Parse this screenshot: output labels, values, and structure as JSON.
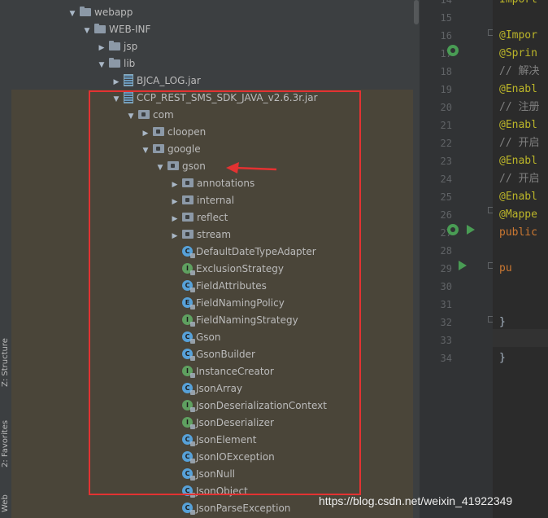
{
  "sidebar_tabs": {
    "structure": "Z: Structure",
    "favorites": "2: Favorites",
    "web": "Web"
  },
  "tree": [
    {
      "label": "webapp",
      "icon": "folder-icon",
      "arrow": "▼"
    },
    {
      "label": "WEB-INF",
      "icon": "folder-icon",
      "arrow": "▼"
    },
    {
      "label": "jsp",
      "icon": "folder-icon",
      "arrow": "▶"
    },
    {
      "label": "lib",
      "icon": "folder-icon",
      "arrow": "▼"
    },
    {
      "label": "BJCA_LOG.jar",
      "icon": "jar-icon",
      "arrow": "▶"
    },
    {
      "label": "CCP_REST_SMS_SDK_JAVA_v2.6.3r.jar",
      "icon": "jar-icon",
      "arrow": "▼"
    },
    {
      "label": "com",
      "icon": "package-icon",
      "arrow": "▼"
    },
    {
      "label": "cloopen",
      "icon": "package-icon",
      "arrow": "▶"
    },
    {
      "label": "google",
      "icon": "package-icon",
      "arrow": "▼"
    },
    {
      "label": "gson",
      "icon": "package-icon",
      "arrow": "▼"
    },
    {
      "label": "annotations",
      "icon": "package-icon",
      "arrow": "▶"
    },
    {
      "label": "internal",
      "icon": "package-icon",
      "arrow": "▶"
    },
    {
      "label": "reflect",
      "icon": "package-icon",
      "arrow": "▶"
    },
    {
      "label": "stream",
      "icon": "package-icon",
      "arrow": "▶"
    },
    {
      "label": "DefaultDateTypeAdapter",
      "icon": "class-icon",
      "kind": "C"
    },
    {
      "label": "ExclusionStrategy",
      "icon": "interface-icon",
      "kind": "I"
    },
    {
      "label": "FieldAttributes",
      "icon": "class-icon",
      "kind": "C"
    },
    {
      "label": "FieldNamingPolicy",
      "icon": "enum-icon",
      "kind": "E"
    },
    {
      "label": "FieldNamingStrategy",
      "icon": "interface-icon",
      "kind": "I"
    },
    {
      "label": "Gson",
      "icon": "class-icon",
      "kind": "C"
    },
    {
      "label": "GsonBuilder",
      "icon": "class-icon",
      "kind": "C"
    },
    {
      "label": "InstanceCreator",
      "icon": "interface-icon",
      "kind": "I"
    },
    {
      "label": "JsonArray",
      "icon": "class-icon",
      "kind": "C"
    },
    {
      "label": "JsonDeserializationContext",
      "icon": "interface-icon",
      "kind": "I"
    },
    {
      "label": "JsonDeserializer",
      "icon": "interface-icon",
      "kind": "I"
    },
    {
      "label": "JsonElement",
      "icon": "abstract-class-icon",
      "kind": "C"
    },
    {
      "label": "JsonIOException",
      "icon": "exception-class-icon",
      "kind": "C"
    },
    {
      "label": "JsonNull",
      "icon": "class-icon",
      "kind": "C"
    },
    {
      "label": "JsonObject",
      "icon": "class-icon",
      "kind": "C"
    },
    {
      "label": "JsonParseException",
      "icon": "exception-class-icon",
      "kind": "C"
    }
  ],
  "gutter": {
    "line_numbers": [
      "14",
      "15",
      "16",
      "17",
      "18",
      "19",
      "20",
      "21",
      "22",
      "23",
      "24",
      "25",
      "26",
      "27",
      "28",
      "29",
      "30",
      "31",
      "32",
      "33",
      "34"
    ]
  },
  "code_lines": [
    {
      "text": "Import",
      "cls": "c-ann"
    },
    {
      "text": "",
      "cls": "c-txt"
    },
    {
      "text": "@Impor",
      "cls": "c-ann"
    },
    {
      "text": "@Sprin",
      "cls": "c-ann"
    },
    {
      "text": "// 解决",
      "cls": "c-cmt"
    },
    {
      "text": "@Enabl",
      "cls": "c-ann"
    },
    {
      "text": "// 注册",
      "cls": "c-cmt"
    },
    {
      "text": "@Enabl",
      "cls": "c-ann"
    },
    {
      "text": "// 开启",
      "cls": "c-cmt"
    },
    {
      "text": "@Enabl",
      "cls": "c-ann"
    },
    {
      "text": "// 开启",
      "cls": "c-cmt"
    },
    {
      "text": "@Enabl",
      "cls": "c-ann"
    },
    {
      "text": "@Mappe",
      "cls": "c-ann"
    },
    {
      "text": "public",
      "cls": "c-kw"
    },
    {
      "text": "",
      "cls": "c-txt"
    },
    {
      "text": "    pu",
      "cls": "c-kw"
    },
    {
      "text": "",
      "cls": "c-txt"
    },
    {
      "text": "",
      "cls": "c-txt"
    },
    {
      "text": "    }",
      "cls": "c-txt"
    },
    {
      "text": "",
      "cls": "c-txt"
    },
    {
      "text": "}",
      "cls": "c-txt"
    },
    {
      "text": "",
      "cls": "c-txt"
    }
  ],
  "watermark": "https://blog.csdn.net/weixin_41922349",
  "colors": {
    "annotation_box": "#e33232",
    "selection": "#4a4539",
    "panel_bg": "#3c3f41",
    "editor_bg": "#2b2b2b"
  }
}
